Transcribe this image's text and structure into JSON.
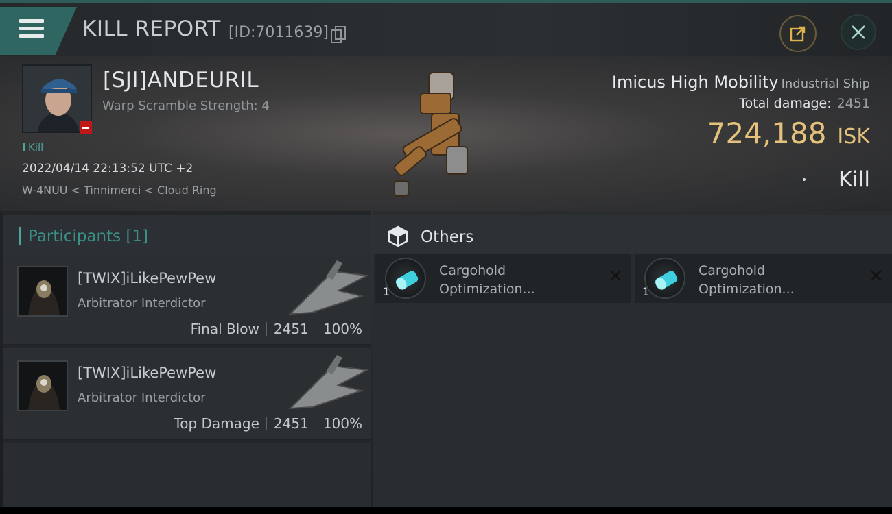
{
  "header": {
    "title": "KILL REPORT",
    "report_id": "[ID:7011639]"
  },
  "victim": {
    "name": "[SJI]ANDEURIL",
    "warp_scramble": "Warp Scramble Strength: 4",
    "tag": "Kill",
    "datetime": "2022/04/14 22:13:52 UTC +2",
    "location": "W-4NUU < Tinnimerci < Cloud Ring",
    "ship_name": "Imicus High Mobility",
    "ship_class": "Industrial Ship",
    "total_damage_label": "Total damage:",
    "total_damage": "2451",
    "isk_value": "724,188",
    "isk_unit": "ISK",
    "kill_type": "Kill"
  },
  "participants": {
    "label": "Participants [1]",
    "rows": [
      {
        "name": "[TWIX]iLikePewPew",
        "ship": "Arbitrator Interdictor",
        "role": "Final Blow",
        "damage": "2451",
        "percent": "100%"
      },
      {
        "name": "[TWIX]iLikePewPew",
        "ship": "Arbitrator Interdictor",
        "role": "Top Damage",
        "damage": "2451",
        "percent": "100%"
      }
    ]
  },
  "others": {
    "label": "Others",
    "items": [
      {
        "qty": "1",
        "name_line1": "Cargohold",
        "name_line2": "Optimization..."
      },
      {
        "qty": "1",
        "name_line1": "Cargohold",
        "name_line2": "Optimization..."
      }
    ]
  },
  "colors": {
    "accent_teal": "#2f6661",
    "isk_gold": "#e4c27c",
    "badge_red": "#c01818"
  },
  "icons": [
    "menu-icon",
    "copy-icon",
    "share-icon",
    "close-icon",
    "cube-icon",
    "module-icon",
    "remove-icon"
  ]
}
